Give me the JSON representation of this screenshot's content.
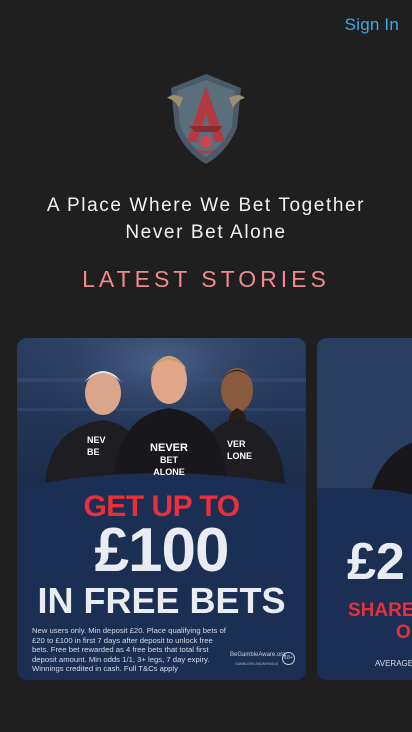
{
  "header": {
    "sign_in_label": "Sign In"
  },
  "tagline": {
    "line1": "A Place Where We Bet Together",
    "line2": "Never Bet Alone"
  },
  "section": {
    "title": "LATEST STORIES"
  },
  "stories": [
    {
      "shirt_line1": "NEVER",
      "shirt_line2": "BET ALONE",
      "shirt_left_1": "NEV",
      "shirt_left_2": "BE",
      "shirt_right_1": "VER",
      "shirt_right_2": "LONE",
      "headline_top": "GET UP TO",
      "headline_amount": "£100",
      "headline_bottom": "IN FREE BETS",
      "terms": "New users only. Min deposit £20. Place qualifying bets of £20 to £100 in first 7 days after deposit to unlock free bets. Free bet rewarded as 4 free bets that total first deposit amount. Min odds 1/1, 3+ legs, 7 day expiry. Winnings credited in cash. Full T&Cs apply",
      "gamble_aware": "BeGambleAware.org",
      "gamble_aware_sub": "GAMBLERS ANONYMOUS",
      "age_badge": "18+"
    },
    {
      "headline_amount": "£2",
      "headline_line1": "SHARE",
      "headline_line2": "O",
      "small_text": "AVERAGE C"
    }
  ],
  "colors": {
    "accent_link": "#3fa7e6",
    "section_title": "#f08a8e",
    "promo_red": "#e8303a",
    "background": "#1f1f20"
  }
}
